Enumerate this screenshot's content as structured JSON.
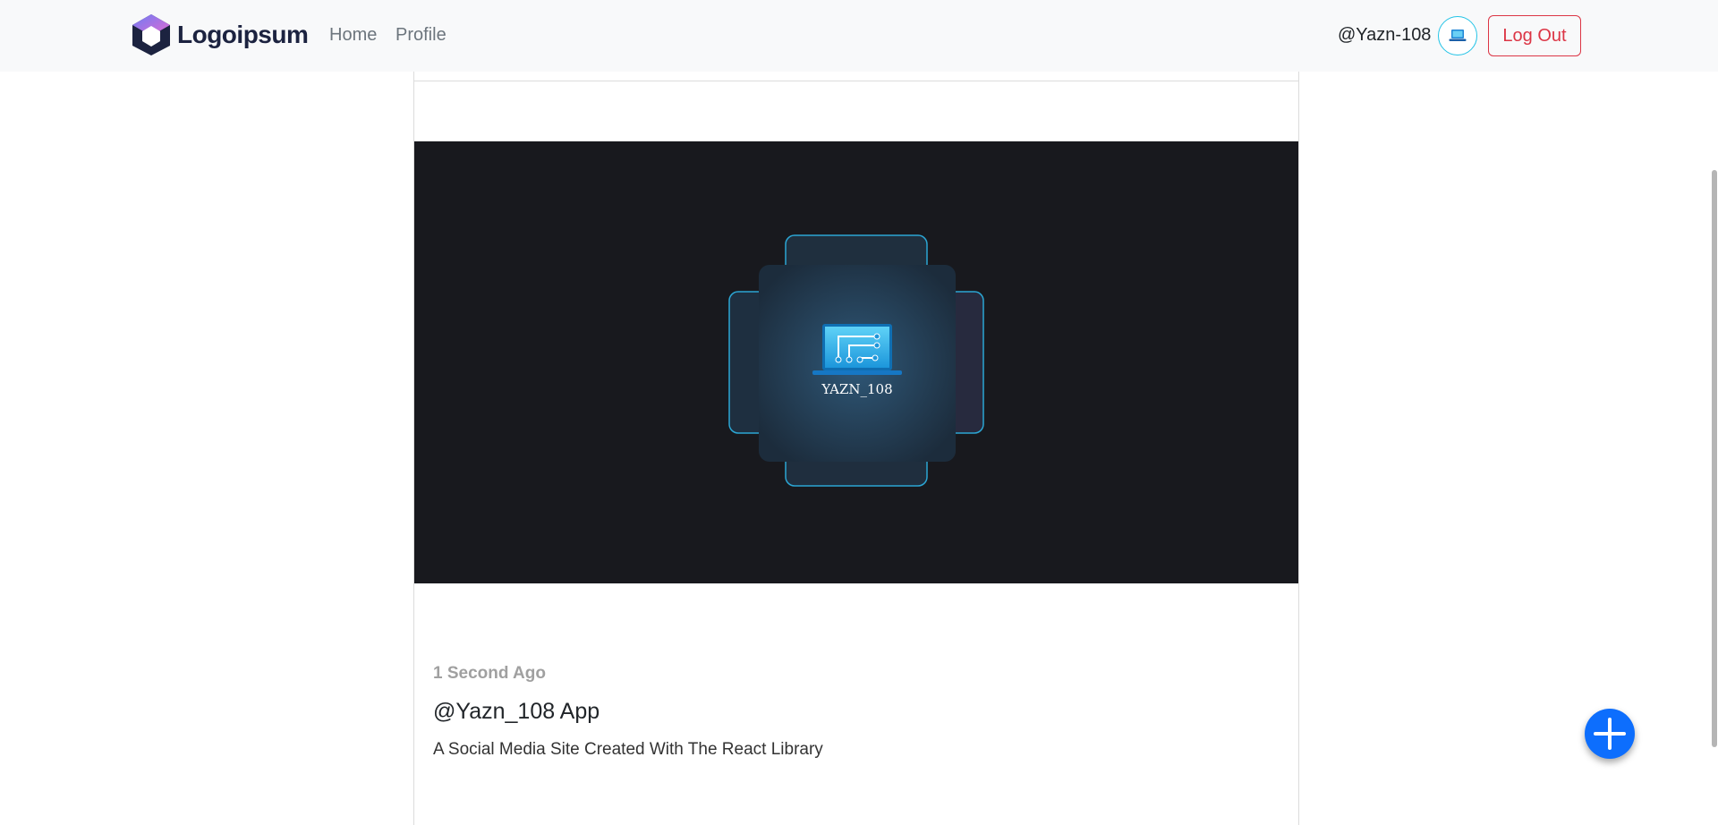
{
  "navbar": {
    "brand": "Logoipsum",
    "links": [
      {
        "label": "Home"
      },
      {
        "label": "Profile"
      }
    ],
    "username": "@Yazn-108",
    "logout_label": "Log Out"
  },
  "post": {
    "image_label": "YAZN_108",
    "time": "1 Second Ago",
    "title": "@Yazn_108 App",
    "text": "A Social Media Site Created With The React Library"
  },
  "colors": {
    "primary": "#0d6efd",
    "danger": "#dc3545",
    "accent": "#22c3e6",
    "navbar_bg": "#f8f9fa",
    "image_bg": "#18191e"
  },
  "icons": {
    "fab": "plus-icon",
    "avatar": "laptop-icon",
    "brand": "hexagon-logo-icon"
  }
}
